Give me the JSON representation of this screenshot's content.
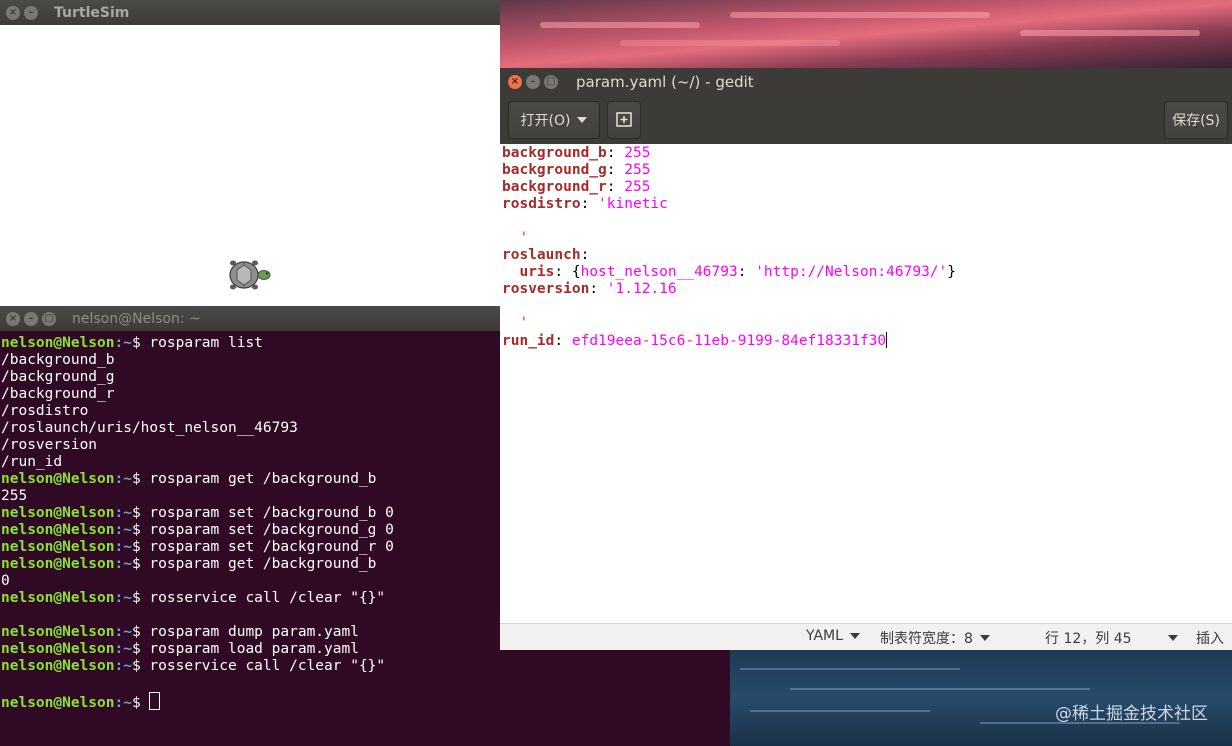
{
  "turtlesim": {
    "title": "TurtleSim"
  },
  "terminal": {
    "title": "nelson@Nelson: ~",
    "prompt_user": "nelson@Nelson",
    "prompt_path": ":~",
    "lines": [
      {
        "prompt": true,
        "cmd": "$ rosparam list"
      },
      {
        "prompt": false,
        "text": "/background_b"
      },
      {
        "prompt": false,
        "text": "/background_g"
      },
      {
        "prompt": false,
        "text": "/background_r"
      },
      {
        "prompt": false,
        "text": "/rosdistro"
      },
      {
        "prompt": false,
        "text": "/roslaunch/uris/host_nelson__46793"
      },
      {
        "prompt": false,
        "text": "/rosversion"
      },
      {
        "prompt": false,
        "text": "/run_id"
      },
      {
        "prompt": true,
        "cmd": "$ rosparam get /background_b"
      },
      {
        "prompt": false,
        "text": "255"
      },
      {
        "prompt": true,
        "cmd": "$ rosparam set /background_b 0"
      },
      {
        "prompt": true,
        "cmd": "$ rosparam set /background_g 0"
      },
      {
        "prompt": true,
        "cmd": "$ rosparam set /background_r 0"
      },
      {
        "prompt": true,
        "cmd": "$ rosparam get /background_b"
      },
      {
        "prompt": false,
        "text": "0"
      },
      {
        "prompt": true,
        "cmd": "$ rosservice call /clear \"{}\""
      },
      {
        "prompt": false,
        "text": ""
      },
      {
        "prompt": true,
        "cmd": "$ rosparam dump param.yaml"
      },
      {
        "prompt": true,
        "cmd": "$ rosparam load param.yaml"
      },
      {
        "prompt": true,
        "cmd": "$ rosservice call /clear \"{}\""
      },
      {
        "prompt": false,
        "text": ""
      },
      {
        "prompt": true,
        "cmd": "$ ",
        "cursor": true
      }
    ]
  },
  "gedit": {
    "title": "param.yaml (~/) - gedit",
    "open_label": "打开(O)",
    "save_label": "保存(S)",
    "editor_lines": [
      [
        {
          "c": "k",
          "t": "background_b"
        },
        {
          "c": "t",
          "t": ": "
        },
        {
          "c": "v",
          "t": "255"
        }
      ],
      [
        {
          "c": "k",
          "t": "background_g"
        },
        {
          "c": "t",
          "t": ": "
        },
        {
          "c": "v",
          "t": "255"
        }
      ],
      [
        {
          "c": "k",
          "t": "background_r"
        },
        {
          "c": "t",
          "t": ": "
        },
        {
          "c": "v",
          "t": "255"
        }
      ],
      [
        {
          "c": "k",
          "t": "rosdistro"
        },
        {
          "c": "t",
          "t": ": "
        },
        {
          "c": "v",
          "t": "'kinetic"
        }
      ],
      [],
      [
        {
          "c": "v",
          "t": "  '"
        }
      ],
      [
        {
          "c": "k",
          "t": "roslaunch"
        },
        {
          "c": "t",
          "t": ":"
        }
      ],
      [
        {
          "c": "t",
          "t": "  "
        },
        {
          "c": "k",
          "t": "uris"
        },
        {
          "c": "t",
          "t": ": {"
        },
        {
          "c": "v",
          "t": "host_nelson__46793"
        },
        {
          "c": "t",
          "t": ": "
        },
        {
          "c": "v",
          "t": "'http://Nelson:46793/'"
        },
        {
          "c": "t",
          "t": "}"
        }
      ],
      [
        {
          "c": "k",
          "t": "rosversion"
        },
        {
          "c": "t",
          "t": ": "
        },
        {
          "c": "v",
          "t": "'1.12.16"
        }
      ],
      [],
      [
        {
          "c": "v",
          "t": "  '"
        }
      ],
      [
        {
          "c": "k",
          "t": "run_id"
        },
        {
          "c": "t",
          "t": ": "
        },
        {
          "c": "v",
          "t": "efd19eea-15c6-11eb-9199-84ef18331f30"
        },
        {
          "c": "caret",
          "t": ""
        }
      ]
    ],
    "status": {
      "language": "YAML",
      "tab_width": "制表符宽度：8",
      "position": "行 12，列 45",
      "mode": "插入"
    }
  },
  "watermark": "@稀土掘金技术社区"
}
